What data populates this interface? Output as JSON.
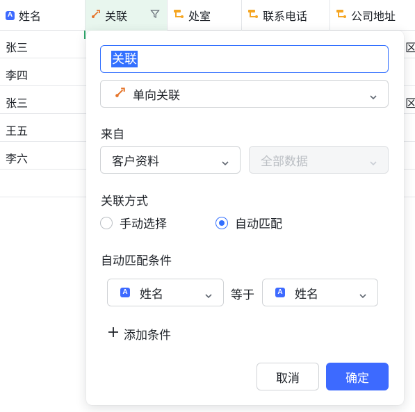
{
  "table": {
    "headers": [
      {
        "label": "姓名",
        "icon": "text-field-icon"
      },
      {
        "label": "关联",
        "icon": "link-field-icon"
      },
      {
        "label": "处室",
        "icon": "lookup-field-icon"
      },
      {
        "label": "联系电话",
        "icon": "lookup-field-icon"
      },
      {
        "label": "公司地址",
        "icon": "lookup-field-icon"
      }
    ],
    "rows": [
      "张三",
      "李四",
      "张三",
      "王五",
      "李六"
    ],
    "partial_cell_char": "区"
  },
  "popup": {
    "field_name_value": "关联",
    "field_type": "单向关联",
    "from_label": "来自",
    "from_table": "客户资料",
    "from_scope": "全部数据",
    "link_mode_label": "关联方式",
    "mode_manual": "手动选择",
    "mode_auto": "自动匹配",
    "selected_mode": "auto",
    "condition_label": "自动匹配条件",
    "condition_left_field": "姓名",
    "condition_operator": "等于",
    "condition_right_field": "姓名",
    "add_condition": "添加条件",
    "cancel": "取消",
    "confirm": "确定"
  },
  "colors": {
    "accent": "#3370ff",
    "link_icon": "#e5742a",
    "lookup_icon": "#f5a623",
    "active_column_bg": "#e8f6ee"
  }
}
